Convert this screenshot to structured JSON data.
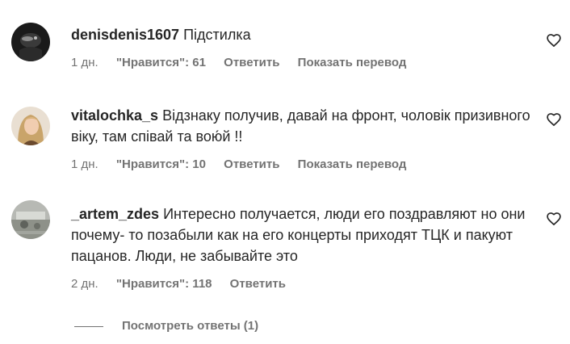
{
  "comments": [
    {
      "username": "denisdenis1607",
      "text": "Підстилка",
      "time": "1 дн.",
      "likes": "\"Нравится\": 61",
      "reply": "Ответить",
      "translate": "Показать перевод"
    },
    {
      "username": "vitalochka_s",
      "text": "Відзнаку получив, давай на фронт, чоловік призивного віку, там співай та вою́й !!",
      "time": "1 дн.",
      "likes": "\"Нравится\": 10",
      "reply": "Ответить",
      "translate": "Показать перевод"
    },
    {
      "username": "_artem_zdes",
      "text": "Интересно получается, люди его поздравляют но они почему- то позабыли как на его концерты приходят ТЦК и пакуют пацанов. Люди, не забывайте это",
      "time": "2 дн.",
      "likes": "\"Нравится\": 118",
      "reply": "Ответить"
    }
  ],
  "view_replies": "Посмотреть ответы (1)",
  "icons": {
    "like": "heart-outline-icon"
  },
  "colors": {
    "text": "#262626",
    "secondary": "#737373",
    "background": "#ffffff"
  }
}
